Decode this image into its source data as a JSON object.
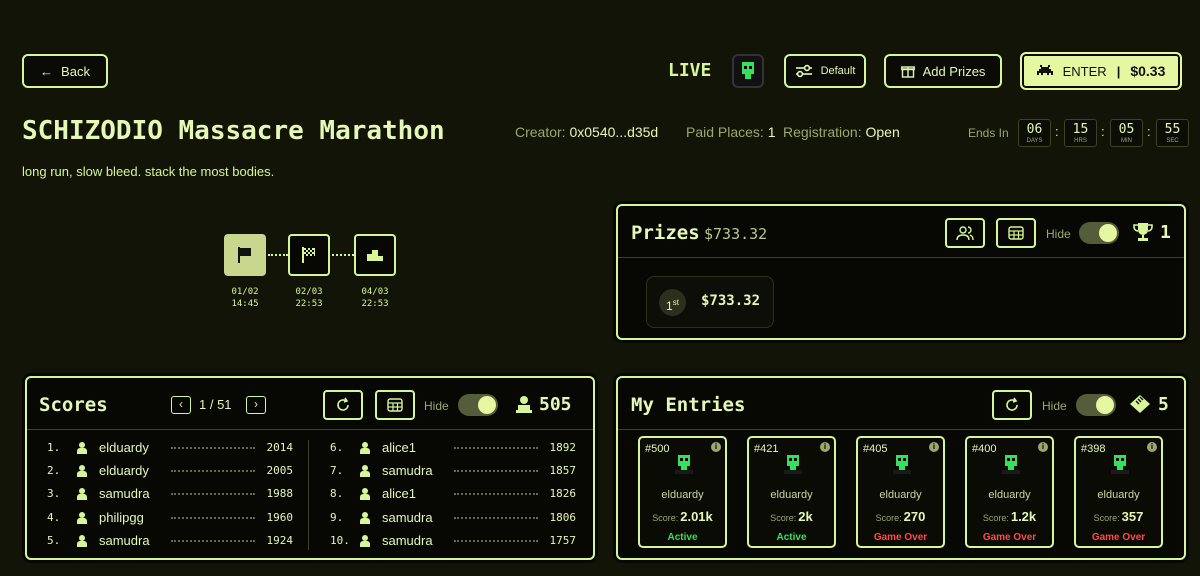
{
  "header": {
    "back_label": "Back",
    "live_label": "LIVE",
    "default_label": "Default",
    "add_prizes_label": "Add Prizes",
    "enter_label": "ENTER",
    "enter_sep": "|",
    "enter_price": "$0.33"
  },
  "tournament": {
    "title": "SCHIZODIO Massacre Marathon",
    "creator_label": "Creator:",
    "creator_value": "0x0540...d35d",
    "paid_places_label": "Paid Places:",
    "paid_places_value": "1",
    "registration_label": "Registration:",
    "registration_value": "Open",
    "description": "long run, slow bleed. stack the most bodies."
  },
  "countdown": {
    "label": "Ends In",
    "days": "06",
    "days_label": "DAYS",
    "hrs": "15",
    "hrs_label": "HRS",
    "min": "05",
    "min_label": "MIN",
    "sec": "55",
    "sec_label": "SEC",
    "sep": ":"
  },
  "timeline": [
    {
      "date": "01/02",
      "time": "14:45",
      "icon": "flag-icon"
    },
    {
      "date": "02/03",
      "time": "22:53",
      "icon": "checkered-flag-icon"
    },
    {
      "date": "04/03",
      "time": "22:53",
      "icon": "podium-icon"
    }
  ],
  "prizes": {
    "title": "Prizes",
    "total": "$733.32",
    "hide_label": "Hide",
    "trophy_count": "1",
    "places": [
      {
        "place": "1",
        "suffix": "st",
        "amount": "$733.32"
      }
    ]
  },
  "scores": {
    "title": "Scores",
    "page": "1 / 51",
    "hide_label": "Hide",
    "players_count": "505",
    "rows": [
      {
        "rank": "1.",
        "name": "elduardy",
        "score": "2014"
      },
      {
        "rank": "2.",
        "name": "elduardy",
        "score": "2005"
      },
      {
        "rank": "3.",
        "name": "samudra",
        "score": "1988"
      },
      {
        "rank": "4.",
        "name": "philipgg",
        "score": "1960"
      },
      {
        "rank": "5.",
        "name": "samudra",
        "score": "1924"
      },
      {
        "rank": "6.",
        "name": "alice1",
        "score": "1892"
      },
      {
        "rank": "7.",
        "name": "samudra",
        "score": "1857"
      },
      {
        "rank": "8.",
        "name": "alice1",
        "score": "1826"
      },
      {
        "rank": "9.",
        "name": "samudra",
        "score": "1806"
      },
      {
        "rank": "10.",
        "name": "samudra",
        "score": "1757"
      }
    ]
  },
  "entries": {
    "title": "My Entries",
    "hide_label": "Hide",
    "count": "5",
    "cards": [
      {
        "id": "#500",
        "user": "elduardy",
        "score_label": "Score:",
        "score": "2.01k",
        "status": "Active",
        "status_color": "#35e05a"
      },
      {
        "id": "#421",
        "user": "elduardy",
        "score_label": "Score:",
        "score": "2k",
        "status": "Active",
        "status_color": "#35e05a"
      },
      {
        "id": "#405",
        "user": "elduardy",
        "score_label": "Score:",
        "score": "270",
        "status": "Game Over",
        "status_color": "#ff4a4a"
      },
      {
        "id": "#400",
        "user": "elduardy",
        "score_label": "Score:",
        "score": "1.2k",
        "status": "Game Over",
        "status_color": "#ff4a4a"
      },
      {
        "id": "#398",
        "user": "elduardy",
        "score_label": "Score:",
        "score": "357",
        "status": "Game Over",
        "status_color": "#ff4a4a"
      }
    ]
  },
  "colors": {
    "accent": "#d9f59a",
    "background": "#121407",
    "active": "#35e05a",
    "game_over": "#ff4a4a"
  }
}
